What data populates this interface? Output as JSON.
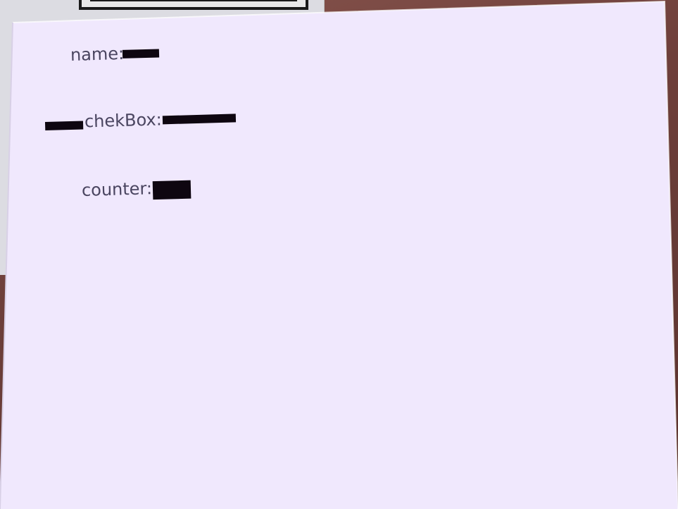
{
  "form": {
    "name_label": "name:",
    "checkbox_label": "chekBox:",
    "counter_label": "counter:"
  },
  "colors": {
    "card_background": "#f0e8fd",
    "label_text": "#4a4560",
    "redaction": "#0e0610"
  }
}
